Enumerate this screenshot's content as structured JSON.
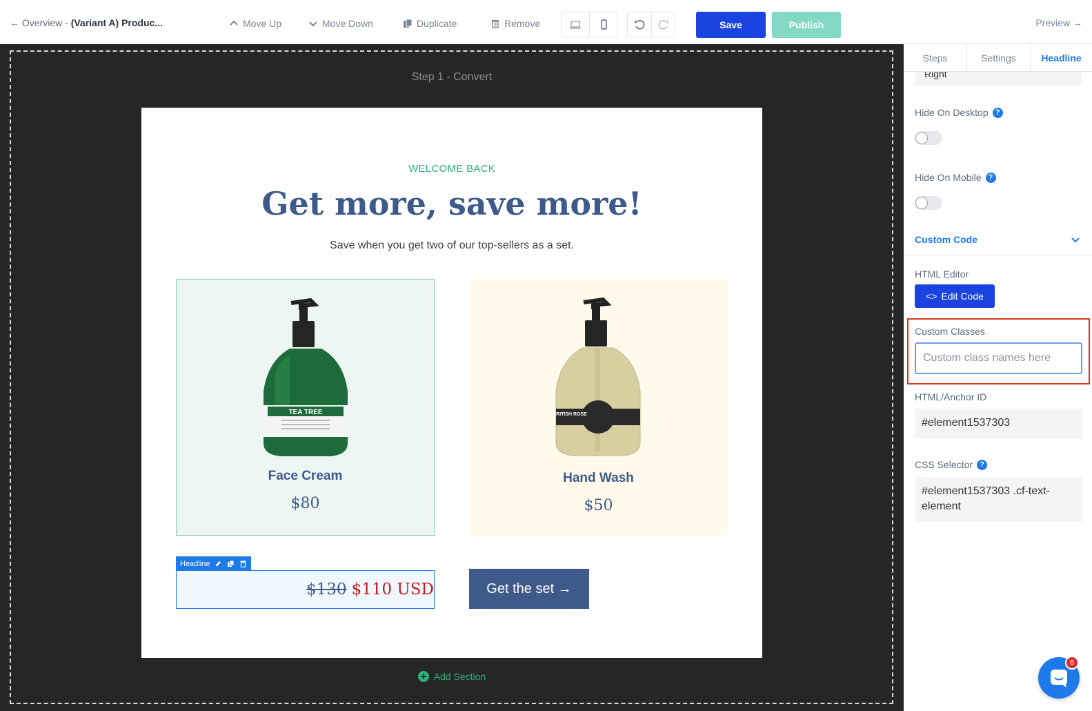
{
  "topbar": {
    "back_prefix": "← Overview - ",
    "page_title": "(Variant A) Produc...",
    "move_up": "Move Up",
    "move_down": "Move Down",
    "duplicate": "Duplicate",
    "remove": "Remove",
    "save": "Save",
    "publish": "Publish",
    "preview": "Preview →"
  },
  "canvas": {
    "step_label": "Step 1 - Convert",
    "welcome": "WELCOME BACK",
    "headline": "Get more, save more!",
    "subheadline": "Save when you get two of our top-sellers as a set.",
    "products": [
      {
        "name": "Face Cream",
        "price": "$80",
        "bottle_label": "TEA TREE"
      },
      {
        "name": "Hand Wash",
        "price": "$50",
        "bottle_label": "BRITISH ROSE"
      }
    ],
    "headline_tag": "Headline",
    "old_price": "$130",
    "new_price": "$110 USD",
    "cta": "Get the set →",
    "add_section": "Add Section"
  },
  "panel": {
    "tabs": [
      "Steps",
      "Settings",
      "Headline"
    ],
    "active_tab": "Headline",
    "clipped_value": "Right",
    "hide_desktop": "Hide On Desktop",
    "hide_mobile": "Hide On Mobile",
    "hide_desktop_on": false,
    "hide_mobile_on": false,
    "custom_code": "Custom Code",
    "html_editor": "HTML Editor",
    "edit_code": "Edit Code",
    "custom_classes": "Custom Classes",
    "custom_classes_placeholder": "Custom class names here",
    "anchor_label": "HTML/Anchor ID",
    "anchor_value": "#element1537303",
    "selector_label": "CSS Selector",
    "selector_value": "#element1537303 .cf-text-element"
  },
  "chat": {
    "badge": "6"
  },
  "colors": {
    "primary": "#1a43e0",
    "publish": "#84d9c5",
    "accent_blue": "#1e7ae8",
    "brand_navy": "#3d5a8a",
    "green": "#2fb07b",
    "sale_red": "#c21d1d",
    "highlight_red": "#d13b1c"
  }
}
